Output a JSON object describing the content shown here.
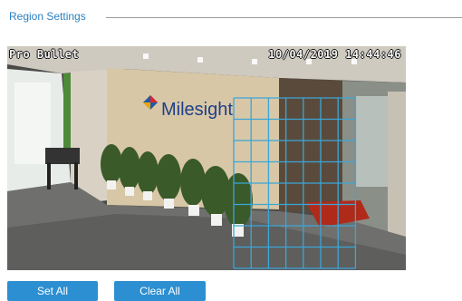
{
  "section": {
    "title": "Region Settings"
  },
  "video": {
    "camera_name": "Pro Bullet",
    "timestamp": "10/04/2019 14:44:46",
    "logo_text": "Milesight"
  },
  "region_grid": {
    "color": "#3aa6d8",
    "columns_selected": 7,
    "rows_selected": 8
  },
  "buttons": {
    "set_all": "Set All",
    "clear_all": "Clear All"
  },
  "colors": {
    "accent": "#2c8fd1",
    "title": "#2b7fc1"
  }
}
